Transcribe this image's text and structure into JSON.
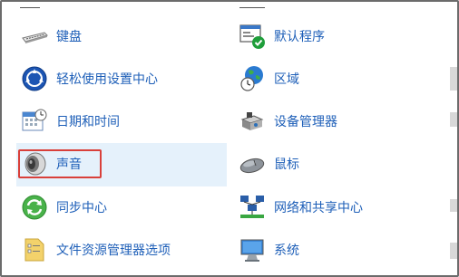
{
  "items": [
    {
      "label": "键盘",
      "icon": "keyboard-icon"
    },
    {
      "label": "默认程序",
      "icon": "default-programs-icon"
    },
    {
      "label": "轻松使用设置中心",
      "icon": "ease-of-access-icon"
    },
    {
      "label": "区域",
      "icon": "region-globe-icon"
    },
    {
      "label": "日期和时间",
      "icon": "date-time-icon"
    },
    {
      "label": "设备管理器",
      "icon": "device-manager-icon"
    },
    {
      "label": "声音",
      "icon": "speaker-icon"
    },
    {
      "label": "鼠标",
      "icon": "mouse-icon"
    },
    {
      "label": "同步中心",
      "icon": "sync-center-icon"
    },
    {
      "label": "网络和共享中心",
      "icon": "network-icon"
    },
    {
      "label": "文件资源管理器选项",
      "icon": "folder-options-icon"
    },
    {
      "label": "系统",
      "icon": "system-monitor-icon"
    }
  ],
  "highlight_color": "#d9403a",
  "link_color": "#1e5fb8"
}
